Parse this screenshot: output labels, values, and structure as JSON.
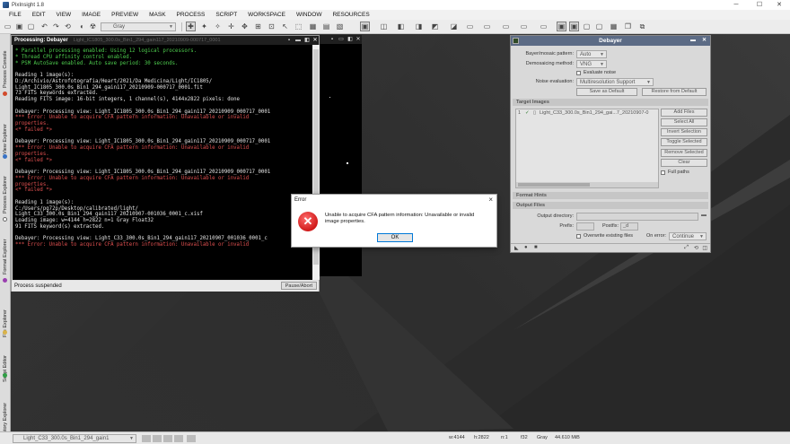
{
  "window": {
    "title": "PixInsight 1.8",
    "minimize": "─",
    "maximize": "☐",
    "close": "✕"
  },
  "menu": [
    "FILE",
    "EDIT",
    "VIEW",
    "IMAGE",
    "PREVIEW",
    "MASK",
    "PROCESS",
    "SCRIPT",
    "WORKSPACE",
    "WINDOW",
    "RESOURCES"
  ],
  "toolbar": {
    "stf_select": "Gray"
  },
  "left_tabs": [
    "Process Console",
    "View Explorer",
    "Process Explorer",
    "Format Explorer",
    "File Explorer",
    "Script Editor",
    "History Explorer"
  ],
  "console": {
    "title": "Processing: Debayer",
    "title_path": "Light_IC1805_300.0s_Bin1_294_gain117_20210909-000717_0001",
    "lines": [
      {
        "t": "* Parallel processing enabled: Using 12 logical processors.",
        "c": "g"
      },
      {
        "t": "* Thread CPU affinity control enabled.",
        "c": "g"
      },
      {
        "t": "* PSM AutoSave enabled. Auto save period: 30 seconds.",
        "c": "g"
      },
      {
        "t": "",
        "c": "w"
      },
      {
        "t": "Reading 1 image(s):",
        "c": "w"
      },
      {
        "t": "D:/Archivio/Astrofotografia/Heart/2021/Da Medicina/Light/IC1805/",
        "c": "w"
      },
      {
        "t": "Light_IC1805_300.0s_Bin1_294_gain117_20210909-000717_0001.fit",
        "c": "w"
      },
      {
        "t": "73 FITS keywords extracted.",
        "c": "w"
      },
      {
        "t": "Reading FITS image: 16-bit integers, 1 channel(s), 4144x2822 pixels: done",
        "c": "w"
      },
      {
        "t": "",
        "c": "w"
      },
      {
        "t": "Debayer: Processing view: Light_IC1805_300.0s_Bin1_294_gain117_20210909_000717_0001",
        "c": "w"
      },
      {
        "t": "*** Error: Unable to acquire CFA pattern information: Unavailable or invalid",
        "c": "r"
      },
      {
        "t": "properties.",
        "c": "r"
      },
      {
        "t": "<* failed *>",
        "c": "r"
      },
      {
        "t": "",
        "c": "w"
      },
      {
        "t": "Debayer: Processing view: Light_IC1805_300.0s_Bin1_294_gain117_20210909_000717_0001",
        "c": "w"
      },
      {
        "t": "*** Error: Unable to acquire CFA pattern information: Unavailable or invalid",
        "c": "r"
      },
      {
        "t": "properties.",
        "c": "r"
      },
      {
        "t": "<* failed *>",
        "c": "r"
      },
      {
        "t": "",
        "c": "w"
      },
      {
        "t": "Debayer: Processing view: Light_IC1805_300.0s_Bin1_294_gain117_20210909_000717_0001",
        "c": "w"
      },
      {
        "t": "*** Error: Unable to acquire CFA pattern information: Unavailable or invalid",
        "c": "r"
      },
      {
        "t": "properties.",
        "c": "r"
      },
      {
        "t": "<* failed *>",
        "c": "r"
      },
      {
        "t": "",
        "c": "w"
      },
      {
        "t": "Reading 1 image(s):",
        "c": "w"
      },
      {
        "t": "C:/Users/pg72p/Desktop/calibrated/light/",
        "c": "w"
      },
      {
        "t": "Light_C33_300.0s_Bin1_294_gain117_20210907-001036_0001_c.xisf",
        "c": "w"
      },
      {
        "t": "Loading image: w=4144 h=2822 n=1 Gray Float32",
        "c": "w"
      },
      {
        "t": "91 FITS keyword(s) extracted.",
        "c": "w"
      },
      {
        "t": "",
        "c": "w"
      },
      {
        "t": "Debayer: Processing view: Light_C33_300.0s_Bin1_294_gain117_20210907_001036_0001_c",
        "c": "w"
      },
      {
        "t": "*** Error: Unable to acquire CFA pattern information: Unavailable or invalid",
        "c": "r"
      }
    ],
    "status": "Process suspended",
    "pause_label": "Pause/Abort"
  },
  "debayer": {
    "title": "Debayer",
    "bayer_label": "Bayer/mosaic pattern:",
    "bayer_value": "Auto",
    "demosaic_label": "Demosaicing method:",
    "demosaic_value": "VNG",
    "evaluate_noise": "Evaluate noise",
    "noise_label": "Noise evaluation:",
    "noise_value": "Multiresolution Support",
    "save_default": "Save as Default",
    "restore_default": "Restore from Default",
    "target_images": "Target Images",
    "target_row_index": "1",
    "target_row_file": "Light_C33_300.0s_Bin1_294_gai...7_20210907-0",
    "add_files": "Add Files",
    "select_all": "Select All",
    "invert_selection": "Invert Selection",
    "toggle_selected": "Toggle Selected",
    "remove_selected": "Remove Selected",
    "clear": "Clear",
    "full_paths": "Full paths",
    "format_hints": "Format Hints",
    "output_files": "Output Files",
    "output_dir_label": "Output directory:",
    "prefix_label": "Prefix:",
    "postfix_label": "Postfix:",
    "postfix_value": "_d",
    "overwrite": "Overwrite existing files",
    "on_error_label": "On error:",
    "on_error_value": "Continue"
  },
  "error_dialog": {
    "title": "Error",
    "message": "Unable to acquire CFA pattern information: Unavailable or invalid image properties.",
    "ok": "OK"
  },
  "statusbar": {
    "view": "Light_C33_300.0s_Bin1_294_gain1",
    "w": "w:4144",
    "h": "h:2822",
    "n": "n:1",
    "bits": "f32",
    "color": "Gray",
    "mem": "44.610 MiB"
  }
}
